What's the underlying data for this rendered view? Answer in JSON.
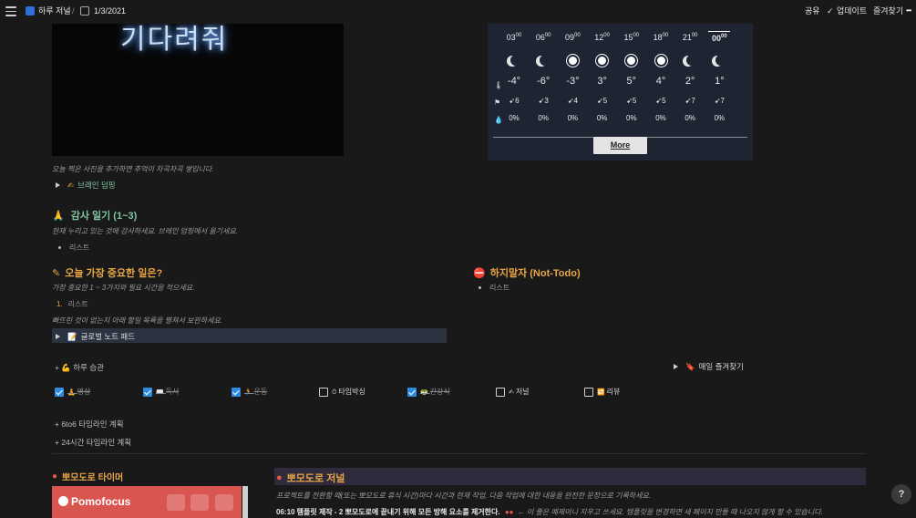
{
  "topbar": {
    "breadcrumb_page": "하루 저널",
    "separator": "/",
    "breadcrumb_date": "1/3/2021",
    "share": "공유",
    "updates": "업데이트",
    "favorite": "즐겨찾기",
    "more": "•••"
  },
  "photo": {
    "sign": "기다려줘"
  },
  "caption_photo": "오늘 찍은 사진을 추가하면 추억이 차곡차곡 쌓입니다.",
  "brain_dump": "브레인 덤핑",
  "gratitude": {
    "title": "감사 일기 (1~3)",
    "desc": "현재 누리고 있는 것에 감사하세요. 브레인 덤핑에서 옮기세요.",
    "item": "리스트"
  },
  "important": {
    "title": "오늘 가장 중요한 일은?",
    "desc": "가장 중요한 1 ~ 3가지와 필요 시간을 적으세요.",
    "num": "1.",
    "item": "리스트",
    "desc2": "빠뜨린 것이 없는지 아래 할일 목록을 펼쳐서 보완하세요.",
    "notepad": "글로벌 노트 패드"
  },
  "not_todo": {
    "title": "하지말자 (Not-Todo)",
    "item": "리스트"
  },
  "weather": {
    "hours": [
      {
        "h": "03",
        "m": "00"
      },
      {
        "h": "06",
        "m": "00"
      },
      {
        "h": "09",
        "m": "00"
      },
      {
        "h": "12",
        "m": "00"
      },
      {
        "h": "15",
        "m": "00"
      },
      {
        "h": "18",
        "m": "00"
      },
      {
        "h": "21",
        "m": "00"
      },
      {
        "h": "00",
        "m": "00"
      }
    ],
    "icons": [
      "moon-icon",
      "moon-icon",
      "sun-icon",
      "sun-icon",
      "sun-icon",
      "sun-icon",
      "moon-icon",
      "wind-moon-icon"
    ],
    "temps": [
      "-4°",
      "-6°",
      "-3°",
      "3°",
      "5°",
      "4°",
      "2°",
      "1°"
    ],
    "wind": [
      "6",
      "3",
      "4",
      "5",
      "5",
      "5",
      "7",
      "7"
    ],
    "precip": [
      "0%",
      "0%",
      "0%",
      "0%",
      "0%",
      "0%",
      "0%",
      "0%"
    ],
    "more": "More"
  },
  "habits": {
    "title": "하루 습관",
    "daily_fav": "매일 즐겨찾기",
    "items": [
      {
        "label": "명상",
        "done": true
      },
      {
        "label": "독서",
        "done": true
      },
      {
        "label": "운동",
        "done": true
      },
      {
        "label": "타임박싱",
        "done": false
      },
      {
        "label": "간강식",
        "done": true
      },
      {
        "label": "저널",
        "done": false
      },
      {
        "label": "리뷰",
        "done": false
      }
    ]
  },
  "timeline1": "6to6 타임라인 계획",
  "timeline2": "24시간 타임라인 계획",
  "pomodoro": {
    "timer_title": "뽀모도로 타이머",
    "app_name": "Pomofocus",
    "journal_title": "뽀모도로 저널",
    "journal_desc": "프로젝트를 전환할 때(또는 뽀모도로 휴식 시간)마다 시간과 현재 작업, 다음 작업에 대한 내용을 완전한 문장으로 기록하세요.",
    "entry": "06:10 템플릿 제작 - 2 뽀모도로에 끝내기 위해 모든 방해 요소를 제거한다.",
    "entry_note": "← 이 줄은 예제이니 지우고 쓰세요. 템플릿을 변경하면 새 페이지 만들 때 나오지 않게 할 수 있습니다."
  },
  "help": "?",
  "colors": {
    "accent_orange": "#e8a545",
    "green": "#7fc6a4",
    "pomodoro_red": "#d95550",
    "checkbox_blue": "#2e8ce0"
  }
}
